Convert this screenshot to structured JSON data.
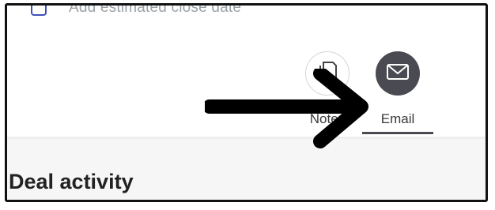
{
  "task": {
    "label": "Add estimated close date"
  },
  "actions": [
    {
      "label": "Notes",
      "icon": "notes-icon"
    },
    {
      "label": "Email",
      "icon": "email-icon"
    }
  ],
  "section": {
    "title": "Deal activity"
  },
  "colors": {
    "email_bg": "#4a4a52",
    "checkbox_border": "#3f51b5",
    "arrow": "#000000"
  }
}
